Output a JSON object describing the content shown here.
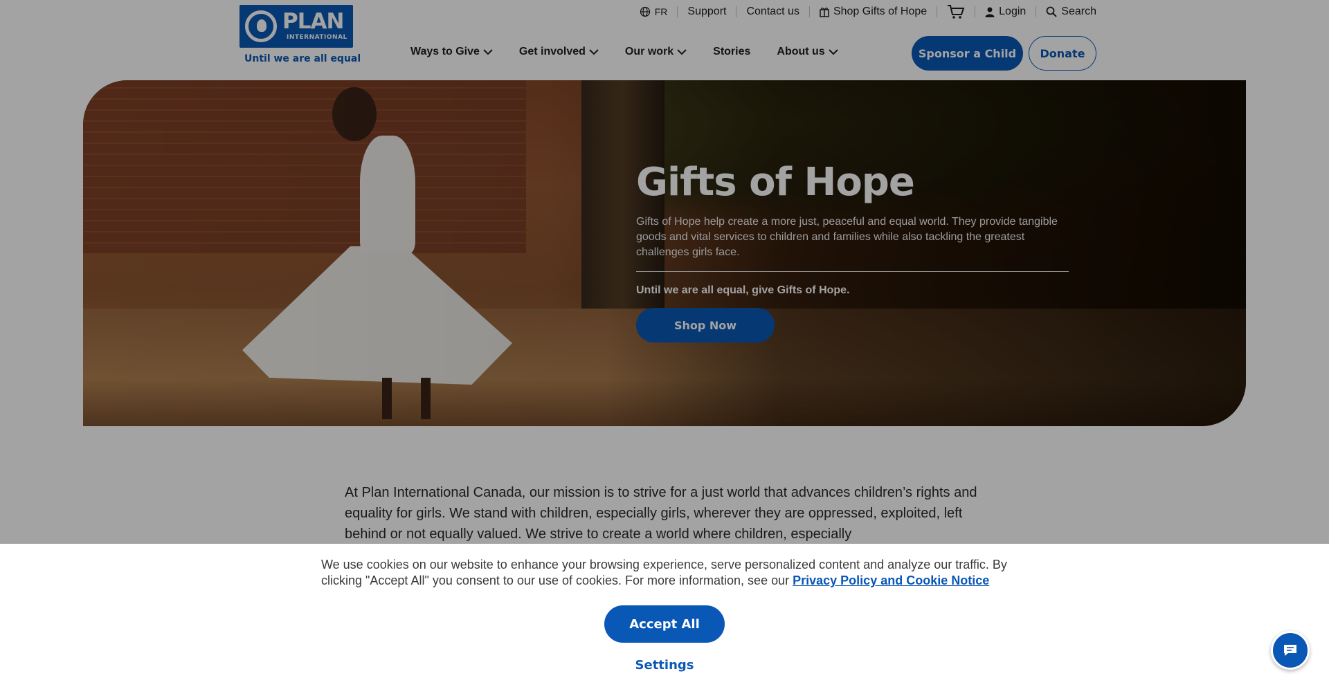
{
  "header": {
    "logo_text": "PLAN",
    "logo_subtext": "INTERNATIONAL",
    "tagline": "Until we are all equal",
    "utility": {
      "language": "FR",
      "support": "Support",
      "contact": "Contact us",
      "shop": "Shop Gifts of Hope",
      "login": "Login",
      "search": "Search"
    },
    "nav": [
      {
        "label": "Ways to Give",
        "has_dropdown": true
      },
      {
        "label": "Get involved",
        "has_dropdown": true
      },
      {
        "label": "Our work",
        "has_dropdown": true
      },
      {
        "label": "Stories",
        "has_dropdown": false
      },
      {
        "label": "About us",
        "has_dropdown": true
      }
    ],
    "sponsor_label": "Sponsor a Child",
    "donate_label": "Donate"
  },
  "hero": {
    "title": "Gifts of Hope",
    "description": "Gifts of Hope help create a more just, peaceful and equal world. They provide tangible goods and vital services to children and families while also tackling the greatest challenges girls face.",
    "strong_line": "Until we are all equal, give Gifts of Hope.",
    "cta_label": "Shop Now"
  },
  "mission": {
    "text": "At Plan International Canada, our mission is to strive for a just world that advances children’s rights and equality for girls. We stand with children, especially girls, wherever they are oppressed, exploited, left behind or not equally valued. We strive to create a world where children, especially"
  },
  "cookie": {
    "text": "We use cookies on our website to enhance your browsing experience, serve personalized content and analyze our traffic. By clicking \"Accept All\" you consent to our use of cookies. For more information, see our",
    "link_label": "Privacy Policy and Cookie Notice",
    "accept_label": "Accept All",
    "settings_label": "Settings"
  },
  "colors": {
    "brand_blue": "#0a58b5",
    "text_dark": "#1f1f1f"
  },
  "icons": {
    "globe": "globe-icon",
    "gift": "gift-icon",
    "cart": "cart-icon",
    "user": "user-icon",
    "search": "search-icon",
    "chevron": "chevron-down-icon",
    "chat": "chat-icon"
  }
}
